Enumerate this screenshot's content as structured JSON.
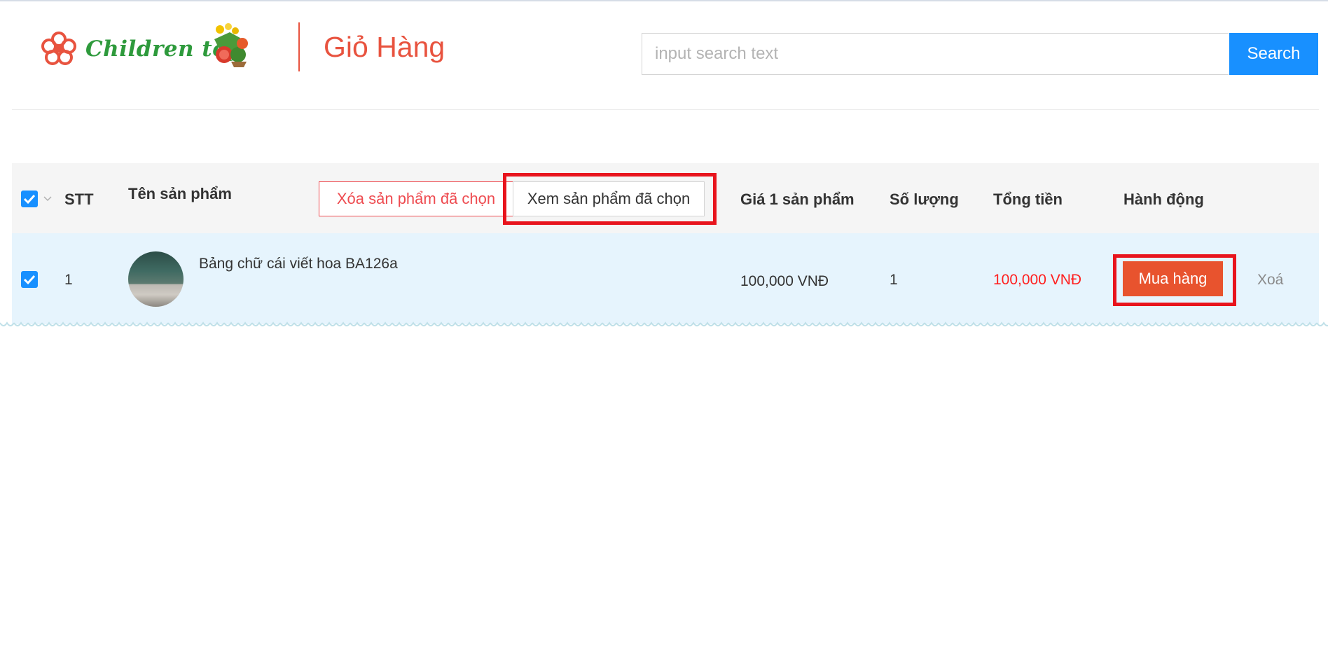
{
  "brand": {
    "logo_text": "Children toy"
  },
  "header": {
    "title": "Giỏ Hàng"
  },
  "search": {
    "placeholder": "input search text",
    "value": "",
    "button_label": "Search"
  },
  "colors": {
    "accent": "#e8533f",
    "primary": "#1890ff",
    "buy": "#e8532e",
    "highlight": "#e8141d",
    "row_bg": "#e6f4fd"
  },
  "table": {
    "headers": {
      "stt": "STT",
      "name": "Tên sản phẩm",
      "unit_price": "Giá 1 sản phẩm",
      "quantity": "Số lượng",
      "total": "Tổng tiền",
      "actions": "Hành động"
    },
    "bulk_actions": {
      "delete_selected": "Xóa sản phẩm đã chọn",
      "view_selected": "Xem sản phẩm đã chọn"
    },
    "select_all_checked": true,
    "rows": [
      {
        "checked": true,
        "stt": "1",
        "name": "Bảng chữ cái viết hoa BA126a",
        "unit_price": "100,000 VNĐ",
        "quantity": "1",
        "total": "100,000 VNĐ",
        "buy_label": "Mua hàng",
        "delete_label": "Xoá"
      }
    ]
  },
  "icons": {
    "logo": "flower-logo-icon",
    "logo_decor": "fruit-basket-icon",
    "checkbox": "checkbox-checked-icon",
    "dropdown": "chevron-down-icon"
  }
}
